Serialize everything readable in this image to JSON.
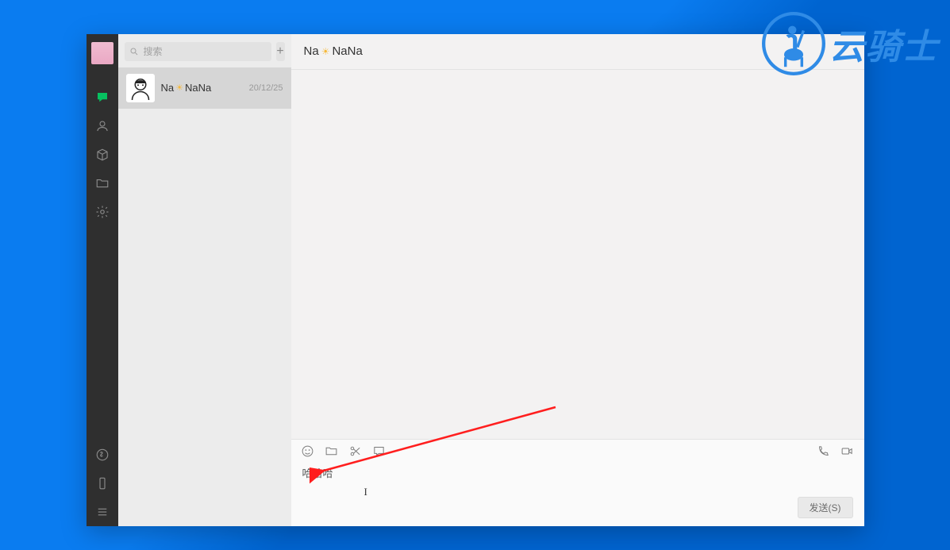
{
  "search": {
    "placeholder": "搜索"
  },
  "addbutton": {
    "label": "+"
  },
  "conversations": [
    {
      "name_pre": "Na",
      "name_post": " NaNa",
      "time": "20/12/25"
    }
  ],
  "chat": {
    "title_pre": "Na",
    "title_post": " NaNa"
  },
  "composer": {
    "text": "哈哈哈",
    "cursor_glyph": "I"
  },
  "send": {
    "label": "发送(S)"
  },
  "watermark": {
    "text": "云骑士"
  }
}
